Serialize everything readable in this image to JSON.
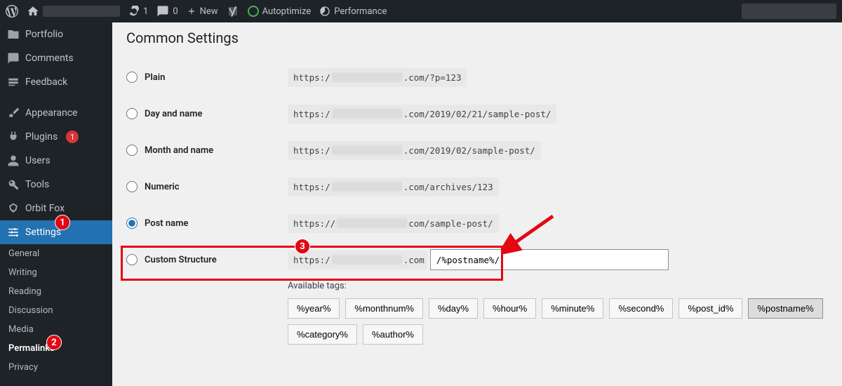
{
  "toolbar": {
    "refresh_count": "1",
    "comment_count": "0",
    "new_label": "New",
    "autoptimize_label": "Autoptimize",
    "performance_label": "Performance"
  },
  "sidebar": {
    "items": [
      {
        "label": "Portfolio"
      },
      {
        "label": "Comments"
      },
      {
        "label": "Feedback"
      },
      {
        "label": "Appearance"
      },
      {
        "label": "Plugins",
        "badge": "1"
      },
      {
        "label": "Users"
      },
      {
        "label": "Tools"
      },
      {
        "label": "Orbit Fox"
      },
      {
        "label": "Settings"
      }
    ],
    "sub": [
      {
        "label": "General"
      },
      {
        "label": "Writing"
      },
      {
        "label": "Reading"
      },
      {
        "label": "Discussion"
      },
      {
        "label": "Media"
      },
      {
        "label": "Permalinks"
      },
      {
        "label": "Privacy"
      }
    ]
  },
  "page": {
    "title": "Common Settings",
    "options": {
      "plain": {
        "label": "Plain",
        "prefix": "https:/",
        "suffix": ".com/?p=123"
      },
      "dayname": {
        "label": "Day and name",
        "prefix": "https:/",
        "suffix": ".com/2019/02/21/sample-post/"
      },
      "monthname": {
        "label": "Month and name",
        "prefix": "https:/",
        "suffix": ".com/2019/02/sample-post/"
      },
      "numeric": {
        "label": "Numeric",
        "prefix": "https:/",
        "suffix": ".com/archives/123"
      },
      "postname": {
        "label": "Post name",
        "prefix": "https://",
        "suffix": "com/sample-post/"
      },
      "custom": {
        "label": "Custom Structure",
        "prefix": "https:/",
        "suffix": ".com",
        "value": "/%postname%/"
      }
    },
    "available_tags_label": "Available tags:",
    "tags": [
      "%year%",
      "%monthnum%",
      "%day%",
      "%hour%",
      "%minute%",
      "%second%",
      "%post_id%",
      "%postname%",
      "%category%",
      "%author%"
    ]
  },
  "annotations": {
    "one": "1",
    "two": "2",
    "three": "3"
  }
}
